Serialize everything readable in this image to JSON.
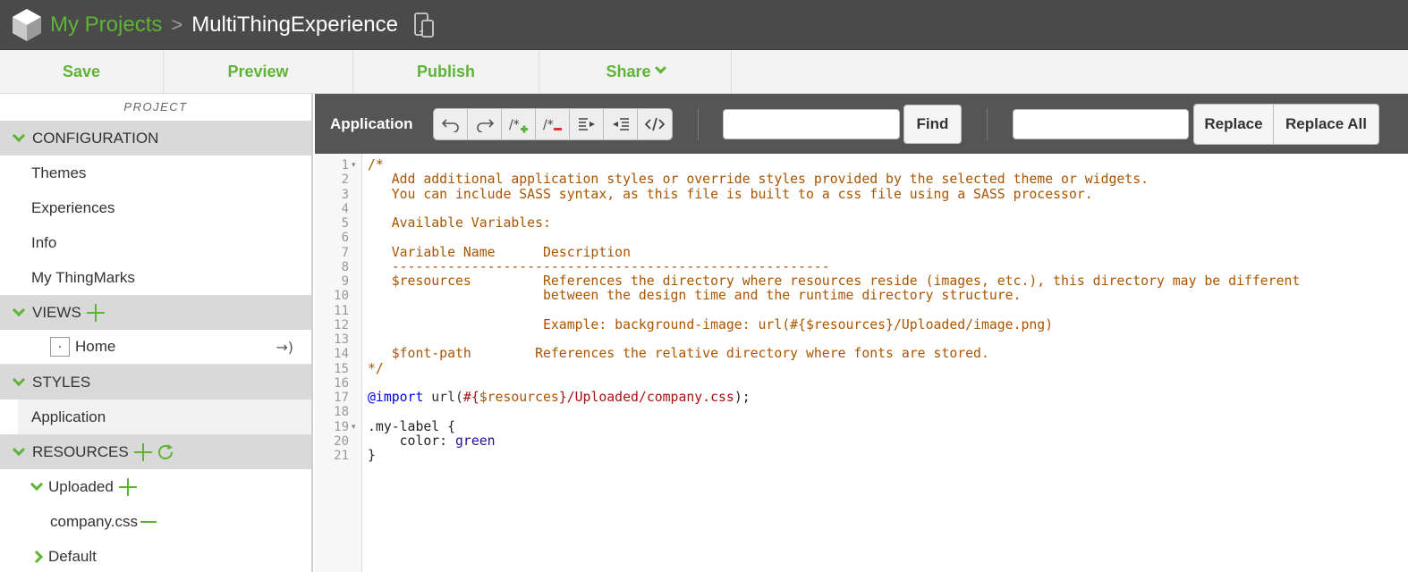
{
  "header": {
    "crumb_projects": "My Projects",
    "crumb_sep": ">",
    "crumb_current": "MultiThingExperience"
  },
  "actions": {
    "save": "Save",
    "preview": "Preview",
    "publish": "Publish",
    "share": "Share"
  },
  "sidebar": {
    "project_label": "PROJECT",
    "configuration": {
      "label": "CONFIGURATION",
      "items": [
        "Themes",
        "Experiences",
        "Info",
        "My ThingMarks"
      ]
    },
    "views": {
      "label": "VIEWS",
      "items": [
        "Home"
      ]
    },
    "styles": {
      "label": "STYLES",
      "items": [
        "Application"
      ]
    },
    "resources": {
      "label": "RESOURCES",
      "uploaded_label": "Uploaded",
      "uploaded_files": [
        "company.css"
      ],
      "default_label": "Default"
    }
  },
  "editor_toolbar": {
    "title": "Application",
    "find_label": "Find",
    "find_value": "",
    "replace_value": "",
    "replace_label": "Replace",
    "replace_all_label": "Replace All"
  },
  "code": {
    "line_numbers": [
      "1",
      "2",
      "3",
      "4",
      "5",
      "6",
      "7",
      "8",
      "9",
      "10",
      "11",
      "12",
      "13",
      "14",
      "15",
      "16",
      "17",
      "18",
      "19",
      "20",
      "21"
    ],
    "lines": [
      [
        {
          "t": "/*",
          "c": "c-comment"
        }
      ],
      [
        {
          "t": "   Add additional application styles or override styles provided by the selected theme or widgets.",
          "c": "c-comment"
        }
      ],
      [
        {
          "t": "   You can include SASS syntax, as this file is built to a css file using a SASS processor.",
          "c": "c-comment"
        }
      ],
      [
        {
          "t": "",
          "c": "c-comment"
        }
      ],
      [
        {
          "t": "   Available Variables:",
          "c": "c-comment"
        }
      ],
      [
        {
          "t": "",
          "c": "c-comment"
        }
      ],
      [
        {
          "t": "   Variable Name      Description",
          "c": "c-comment"
        }
      ],
      [
        {
          "t": "   -------------------------------------------------------",
          "c": "c-comment"
        }
      ],
      [
        {
          "t": "   $resources         References the directory where resources reside (images, etc.), this directory may be different",
          "c": "c-comment"
        }
      ],
      [
        {
          "t": "                      between the design time and the runtime directory structure.",
          "c": "c-comment"
        }
      ],
      [
        {
          "t": "",
          "c": "c-comment"
        }
      ],
      [
        {
          "t": "                      Example: background-image: url(#{$resources}/Uploaded/image.png)",
          "c": "c-comment"
        }
      ],
      [
        {
          "t": "",
          "c": "c-comment"
        }
      ],
      [
        {
          "t": "   $font-path        References the relative directory where fonts are stored.",
          "c": "c-comment"
        }
      ],
      [
        {
          "t": "*/",
          "c": "c-comment"
        }
      ],
      [
        {
          "t": "",
          "c": "c-plain"
        }
      ],
      [
        {
          "t": "@import",
          "c": "c-kw"
        },
        {
          "t": " url(",
          "c": "c-fn"
        },
        {
          "t": "#{",
          "c": "c-str"
        },
        {
          "t": "$resources",
          "c": "c-var"
        },
        {
          "t": "}/Uploaded/company.css",
          "c": "c-str"
        },
        {
          "t": ");",
          "c": "c-plain"
        }
      ],
      [
        {
          "t": "",
          "c": "c-plain"
        }
      ],
      [
        {
          "t": ".my-label {",
          "c": "c-plain"
        }
      ],
      [
        {
          "t": "    color: ",
          "c": "c-plain"
        },
        {
          "t": "green",
          "c": "c-val"
        }
      ],
      [
        {
          "t": "}",
          "c": "c-plain"
        }
      ]
    ],
    "fold_lines": [
      "1",
      "19"
    ]
  },
  "colors": {
    "accent_green": "#5fb336",
    "header_bg": "#4a4a4a",
    "toolbar_bg": "#555555",
    "section_bg": "#d9d9d9"
  }
}
